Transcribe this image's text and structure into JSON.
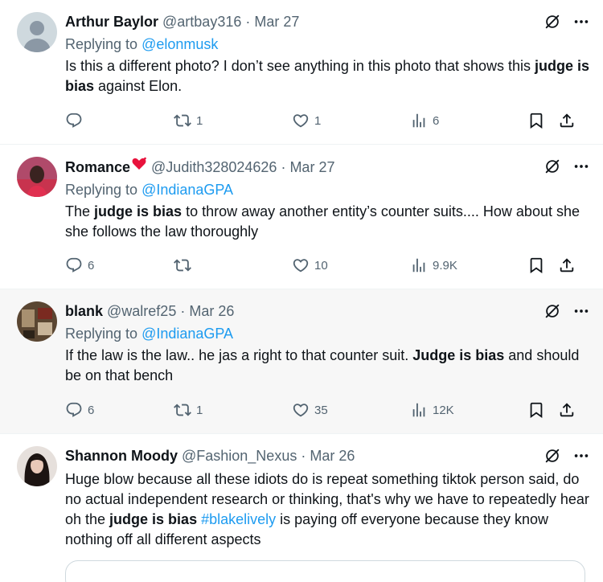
{
  "tweets": [
    {
      "name": "Arthur Baylor",
      "handle": "@artbay316",
      "sep": "·",
      "date": "Mar 27",
      "reply_prefix": "Replying to ",
      "reply_to": "@elonmusk",
      "text": [
        {
          "t": "Is this a different photo? I don’t see anything in this photo that shows this "
        },
        {
          "t": "judge is bias",
          "b": true
        },
        {
          "t": " against Elon."
        }
      ],
      "replies": "",
      "reposts": "1",
      "likes": "1",
      "views": "6",
      "avatar": "default-avatar"
    },
    {
      "name": "Romance",
      "name_emoji": "heart-emoji",
      "handle": "@Judith328024626",
      "sep": "·",
      "date": "Mar 27",
      "reply_prefix": "Replying to ",
      "reply_to": "@IndianaGPA",
      "text": [
        {
          "t": "The "
        },
        {
          "t": "judge is bias",
          "b": true
        },
        {
          "t": " to throw away another entity’s counter suits.... How about she she follows the law thoroughly"
        }
      ],
      "replies": "6",
      "reposts": "",
      "likes": "10",
      "views": "9.9K",
      "avatar": "photo-avatar"
    },
    {
      "name": "blank",
      "handle": "@walref25",
      "sep": "·",
      "date": "Mar 26",
      "reply_prefix": "Replying to ",
      "reply_to": "@IndianaGPA",
      "text": [
        {
          "t": "If the law is the law.. he jas a right to that counter suit. "
        },
        {
          "t": "Judge is bias",
          "b": true
        },
        {
          "t": " and should be on that bench"
        }
      ],
      "replies": "6",
      "reposts": "1",
      "likes": "35",
      "views": "12K",
      "avatar": "photo-avatar"
    },
    {
      "name": "Shannon Moody",
      "handle": "@Fashion_Nexus",
      "sep": "·",
      "date": "Mar 26",
      "text": [
        {
          "t": "Huge blow because all these idiots do is repeat something tiktok person said, do no actual independent research or thinking, that's why we have to repeatedly hear oh the "
        },
        {
          "t": "judge is bias",
          "b": true
        },
        {
          "t": " "
        },
        {
          "t": "#blakelively",
          "h": true
        },
        {
          "t": " is paying off everyone because they know nothing off all different aspects"
        }
      ],
      "avatar": "photo-avatar"
    }
  ],
  "colors": {
    "accent": "#1d9bf0",
    "secondary_text": "#536471",
    "hover_bg": "#f7f7f7",
    "divider": "#eff3f4"
  }
}
